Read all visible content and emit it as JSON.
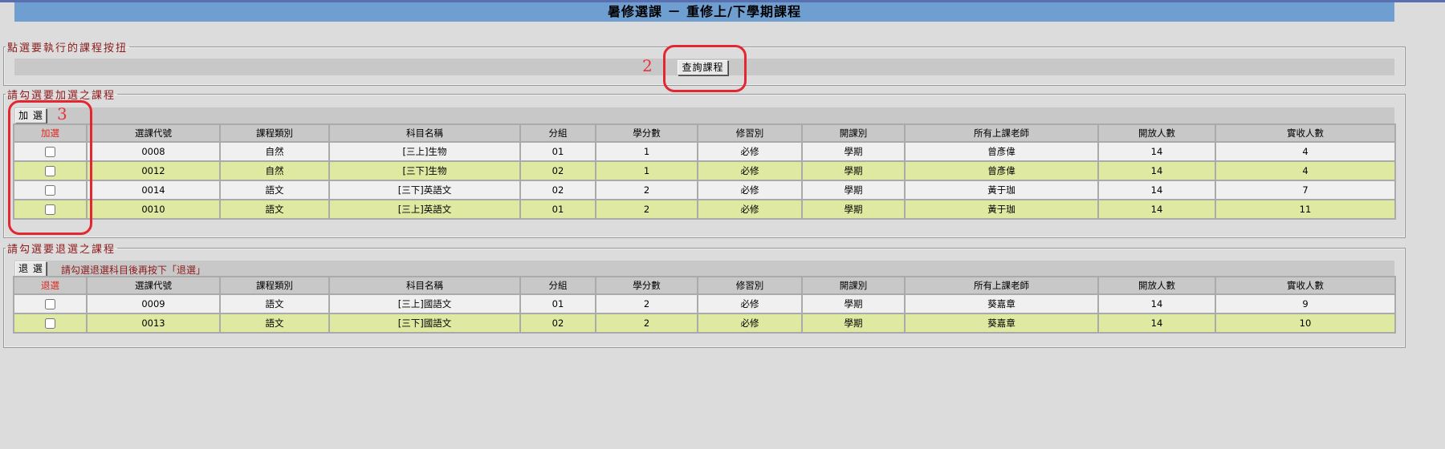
{
  "page_title": "暑修選課 － 重修上/下學期課程",
  "action_section": {
    "legend": "點選要執行的課程按扭",
    "query_button": "查詢課程"
  },
  "add_section": {
    "legend": "請勾選要加選之課程",
    "add_button": "加 選",
    "headers": [
      "加選",
      "選課代號",
      "課程類別",
      "科目名稱",
      "分組",
      "學分數",
      "修習別",
      "開課別",
      "所有上課老師",
      "開放人數",
      "實收人數"
    ],
    "rows": [
      {
        "code": "0008",
        "category": "自然",
        "subject": "[三上]生物",
        "group": "01",
        "credits": "1",
        "type": "必修",
        "term": "學期",
        "teacher": "曾彥偉",
        "open": "14",
        "enrolled": "4"
      },
      {
        "code": "0012",
        "category": "自然",
        "subject": "[三下]生物",
        "group": "02",
        "credits": "1",
        "type": "必修",
        "term": "學期",
        "teacher": "曾彥偉",
        "open": "14",
        "enrolled": "4"
      },
      {
        "code": "0014",
        "category": "語文",
        "subject": "[三下]英語文",
        "group": "02",
        "credits": "2",
        "type": "必修",
        "term": "學期",
        "teacher": "黃于珈",
        "open": "14",
        "enrolled": "7"
      },
      {
        "code": "0010",
        "category": "語文",
        "subject": "[三上]英語文",
        "group": "01",
        "credits": "2",
        "type": "必修",
        "term": "學期",
        "teacher": "黃于珈",
        "open": "14",
        "enrolled": "11"
      }
    ]
  },
  "drop_section": {
    "legend": "請勾選要退選之課程",
    "drop_button": "退 選",
    "note": "請勾選退選科目後再按下「退選」",
    "headers": [
      "退選",
      "選課代號",
      "課程類別",
      "科目名稱",
      "分組",
      "學分數",
      "修習別",
      "開課別",
      "所有上課老師",
      "開放人數",
      "實收人數"
    ],
    "rows": [
      {
        "code": "0009",
        "category": "語文",
        "subject": "[三上]國語文",
        "group": "01",
        "credits": "2",
        "type": "必修",
        "term": "學期",
        "teacher": "葵嘉章",
        "open": "14",
        "enrolled": "9"
      },
      {
        "code": "0013",
        "category": "語文",
        "subject": "[三下]國語文",
        "group": "02",
        "credits": "2",
        "type": "必修",
        "term": "學期",
        "teacher": "葵嘉章",
        "open": "14",
        "enrolled": "10"
      }
    ]
  },
  "annotations": {
    "label_2": "2",
    "label_3": "3",
    "color": "#e3262f"
  },
  "colors": {
    "title_bar": "#6f9fd1",
    "row_odd": "#f0f0f0",
    "row_even": "#e0e9a2",
    "legend_text": "#8b1b1b",
    "checkbox_header": "#e0241a"
  }
}
